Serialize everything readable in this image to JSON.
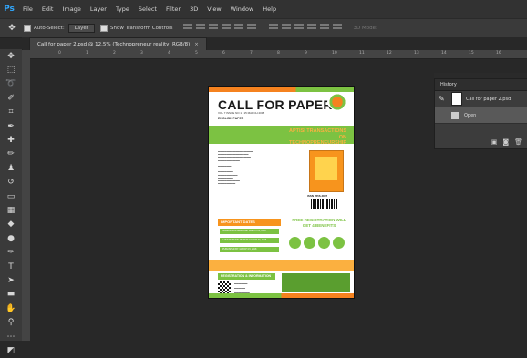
{
  "app": {
    "logo": "Ps"
  },
  "menu": [
    "File",
    "Edit",
    "Image",
    "Layer",
    "Type",
    "Select",
    "Filter",
    "3D",
    "View",
    "Window",
    "Help"
  ],
  "options": {
    "auto_select_label": "Auto-Select:",
    "auto_select_value": "Layer",
    "show_transform_label": "Show Transform Controls",
    "mode_3d_label": "3D Mode:"
  },
  "document_tab": {
    "title": "Call for paper 2.psd @ 12.5% (Technopreneur reality, RGB/8)",
    "close": "×"
  },
  "ruler_ticks": [
    "0",
    "1",
    "2",
    "3",
    "4",
    "5",
    "6",
    "7",
    "8",
    "9",
    "10",
    "11",
    "12",
    "13",
    "14",
    "15",
    "16"
  ],
  "tools": [
    "move-icon",
    "marquee-icon",
    "lasso-icon",
    "quick-select-icon",
    "crop-icon",
    "eyedropper-icon",
    "healing-icon",
    "brush-icon",
    "clone-stamp-icon",
    "history-brush-icon",
    "eraser-icon",
    "gradient-icon",
    "blur-icon",
    "dodge-icon",
    "pen-icon",
    "type-icon",
    "path-select-icon",
    "shape-icon",
    "hand-icon",
    "zoom-icon",
    "more-icon",
    "color-swatch-icon"
  ],
  "poster": {
    "title": "CALL FOR PAPER",
    "subtitle": "VOL 7 ISSUE NO 1 | 15 MARCH 2018",
    "eng": "ENGLISH PAPER",
    "banner": "APTISI TRANSACTIONS ON TECHNOPRENEURSHIP",
    "issn": "ISSN 2656-4807",
    "dates_heading": "IMPORTANT DATES",
    "dates": [
      "SUBMISSION DEADLINE: MARCH 01, 2018",
      "LAST REVISION REVIEW: MARCH 07, 2018",
      "PUBLISHED BY: MARCH 15, 2018"
    ],
    "free": "FREE REGISTRATION WILL GET 4 BENEFITS",
    "reg_heading": "REGISTRATION & INFORMATION"
  },
  "history": {
    "title": "History",
    "items": [
      {
        "label": "Call for paper 2.psd",
        "selected": false
      },
      {
        "label": "Open",
        "selected": true
      }
    ]
  },
  "colors": {
    "green": "#7cc242",
    "orange": "#f5821f",
    "ps_blue": "#31a8ff"
  }
}
